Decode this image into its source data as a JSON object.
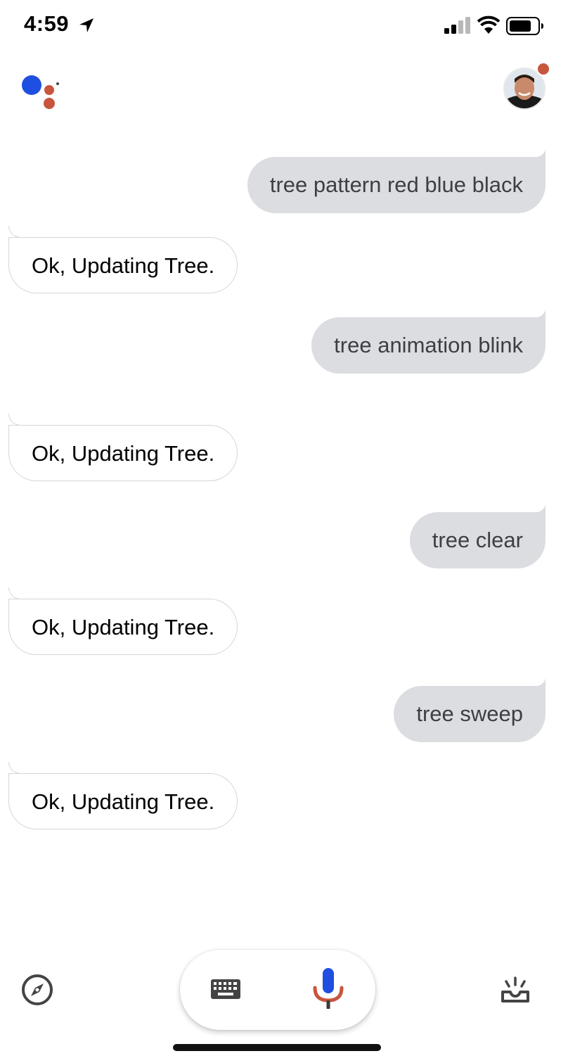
{
  "status_bar": {
    "time": "4:59",
    "icons": [
      "location-arrow-icon",
      "cellular-signal-icon",
      "wifi-icon",
      "battery-icon"
    ]
  },
  "header": {
    "logo": "google-assistant-dots-logo",
    "avatar": "user-avatar",
    "notification_color": "#c8553d"
  },
  "colors": {
    "user_bubble": "#dcdde1",
    "assistant_blue": "#1f4fe0",
    "assistant_red": "#c8553d"
  },
  "conversation": [
    {
      "role": "user",
      "text": "tree pattern red blue black"
    },
    {
      "role": "assistant",
      "text": "Ok, Updating Tree."
    },
    {
      "role": "user",
      "text": "tree animation blink"
    },
    {
      "role": "assistant",
      "text": "Ok, Updating Tree."
    },
    {
      "role": "user",
      "text": "tree clear"
    },
    {
      "role": "assistant",
      "text": "Ok, Updating Tree."
    },
    {
      "role": "user",
      "text": "tree sweep"
    },
    {
      "role": "assistant",
      "text": "Ok, Updating Tree."
    }
  ],
  "bottom_bar": {
    "icons": [
      "explore-compass-icon",
      "keyboard-icon",
      "microphone-icon",
      "updates-tray-icon"
    ]
  }
}
